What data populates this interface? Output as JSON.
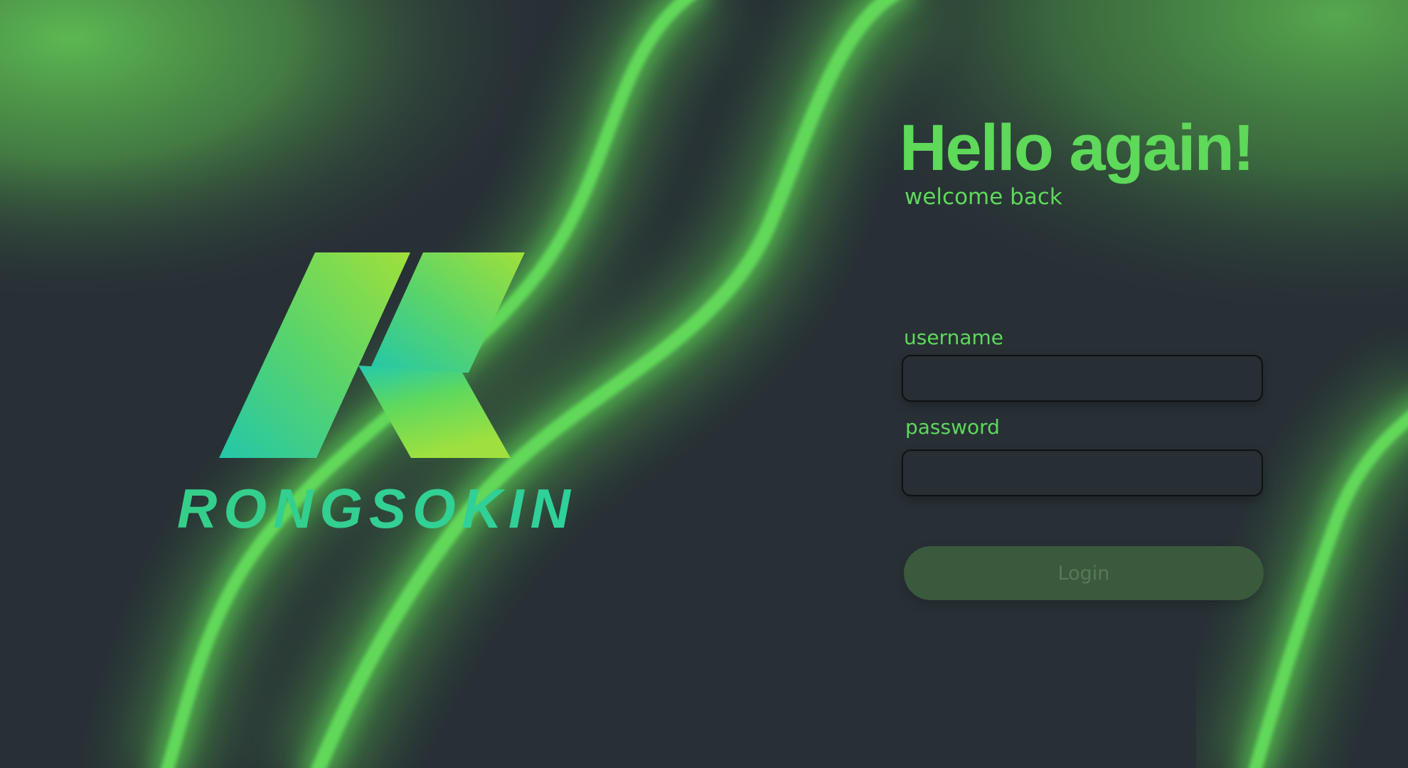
{
  "brand": {
    "name": "RONGSOKIN"
  },
  "login": {
    "headline": "Hello again!",
    "subheadline": "welcome back",
    "username_label": "username",
    "username_value": "",
    "password_label": "password",
    "password_value": "",
    "submit_label": "Login"
  },
  "colors": {
    "background": "#283036",
    "accent": "#5ed95a",
    "button_bg": "#3b5a3d",
    "button_text": "#557a57",
    "logo_gradient_start": "#22c7a9",
    "logo_gradient_end": "#a0e03a"
  }
}
